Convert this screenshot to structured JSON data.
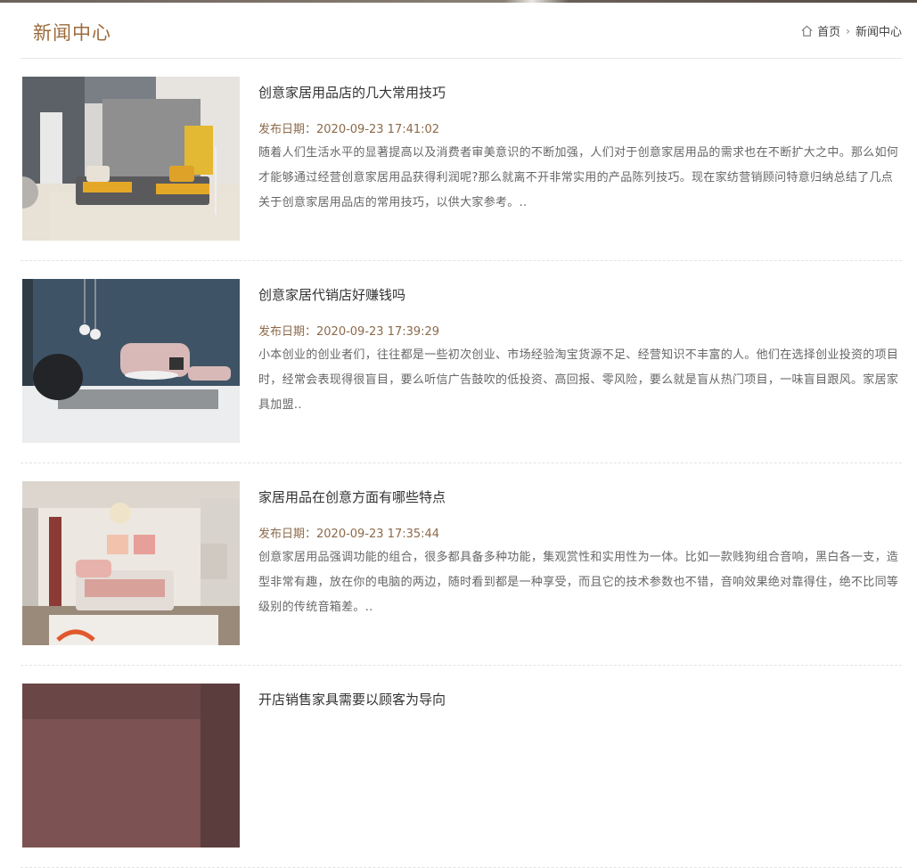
{
  "header": {
    "title": "新闻中心",
    "breadcrumb": {
      "home": "首页",
      "current": "新闻中心"
    }
  },
  "news": [
    {
      "title": "创意家居用品店的几大常用技巧",
      "date": "发布日期：2020-09-23 17:41:02",
      "summary": "随着人们生活水平的显著提高以及消费者审美意识的不断加强，人们对于创意家居用品的需求也在不断扩大之中。那么如何才能够通过经营创意家居用品获得利润呢?那么就离不开非常实用的产品陈列技巧。现在家纺营销顾问特意归纳总结了几点关于创意家居用品店的常用技巧，以供大家参考。.."
    },
    {
      "title": "创意家居代销店好赚钱吗",
      "date": "发布日期：2020-09-23 17:39:29",
      "summary": "小本创业的创业者们，往往都是一些初次创业、市场经验淘宝货源不足、经营知识不丰富的人。他们在选择创业投资的项目时，经常会表现得很盲目，要么听信广告鼓吹的低投资、高回报、零风险，要么就是盲从热门项目，一味盲目跟风。家居家具加盟.."
    },
    {
      "title": "家居用品在创意方面有哪些特点",
      "date": "发布日期：2020-09-23 17:35:44",
      "summary": "创意家居用品强调功能的组合，很多都具备多种功能，集观赏性和实用性为一体。比如一款贱狗组合音响，黑白各一支，造型非常有趣，放在你的电脑的两边，随时看到都是一种享受，而且它的技术参数也不错，音响效果绝对靠得住，绝不比同等级别的传统音箱差。.."
    },
    {
      "title": "开店销售家具需要以顾客为导向",
      "date": "",
      "summary": ""
    }
  ]
}
